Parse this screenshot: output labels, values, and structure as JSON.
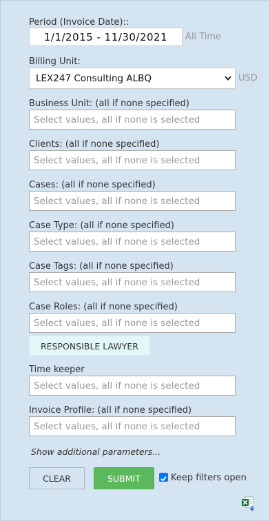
{
  "period": {
    "label": "Period (Invoice Date)::",
    "value": "1/1/2015 - 11/30/2021",
    "all_time_label": "All Time"
  },
  "billing_unit": {
    "label": "Billing Unit:",
    "selected": "LEX247 Consulting ALBQ",
    "currency": "USD"
  },
  "placeholder": "Select values, all if none is selected",
  "filters": {
    "business_unit": "Business Unit: (all if none specified)",
    "clients": "Clients: (all if none specified)",
    "cases": "Cases: (all if none specified)",
    "case_type": "Case Type: (all if none specified)",
    "case_tags": "Case Tags: (all if none specified)",
    "case_roles": "Case Roles: (all if none specified)",
    "time_keeper": "Time keeper",
    "invoice_profile": "Invoice Profile: (all if none specified)"
  },
  "case_roles_chip": "RESPONSIBLE LAWYER",
  "more_link": "Show additional parameters...",
  "buttons": {
    "clear": "CLEAR",
    "submit": "SUBMIT"
  },
  "keep_open": {
    "label": "Keep filters open",
    "checked": true
  },
  "colors": {
    "panel_bg": "#d5e4f1",
    "submit_green": "#5cb85c",
    "checkbox_blue": "#0075ff",
    "chip_bg": "#e2f7f8"
  },
  "icons": {
    "select_arrow": "chevron-down-icon",
    "checkbox": "check-icon",
    "export": "excel-export-icon"
  }
}
